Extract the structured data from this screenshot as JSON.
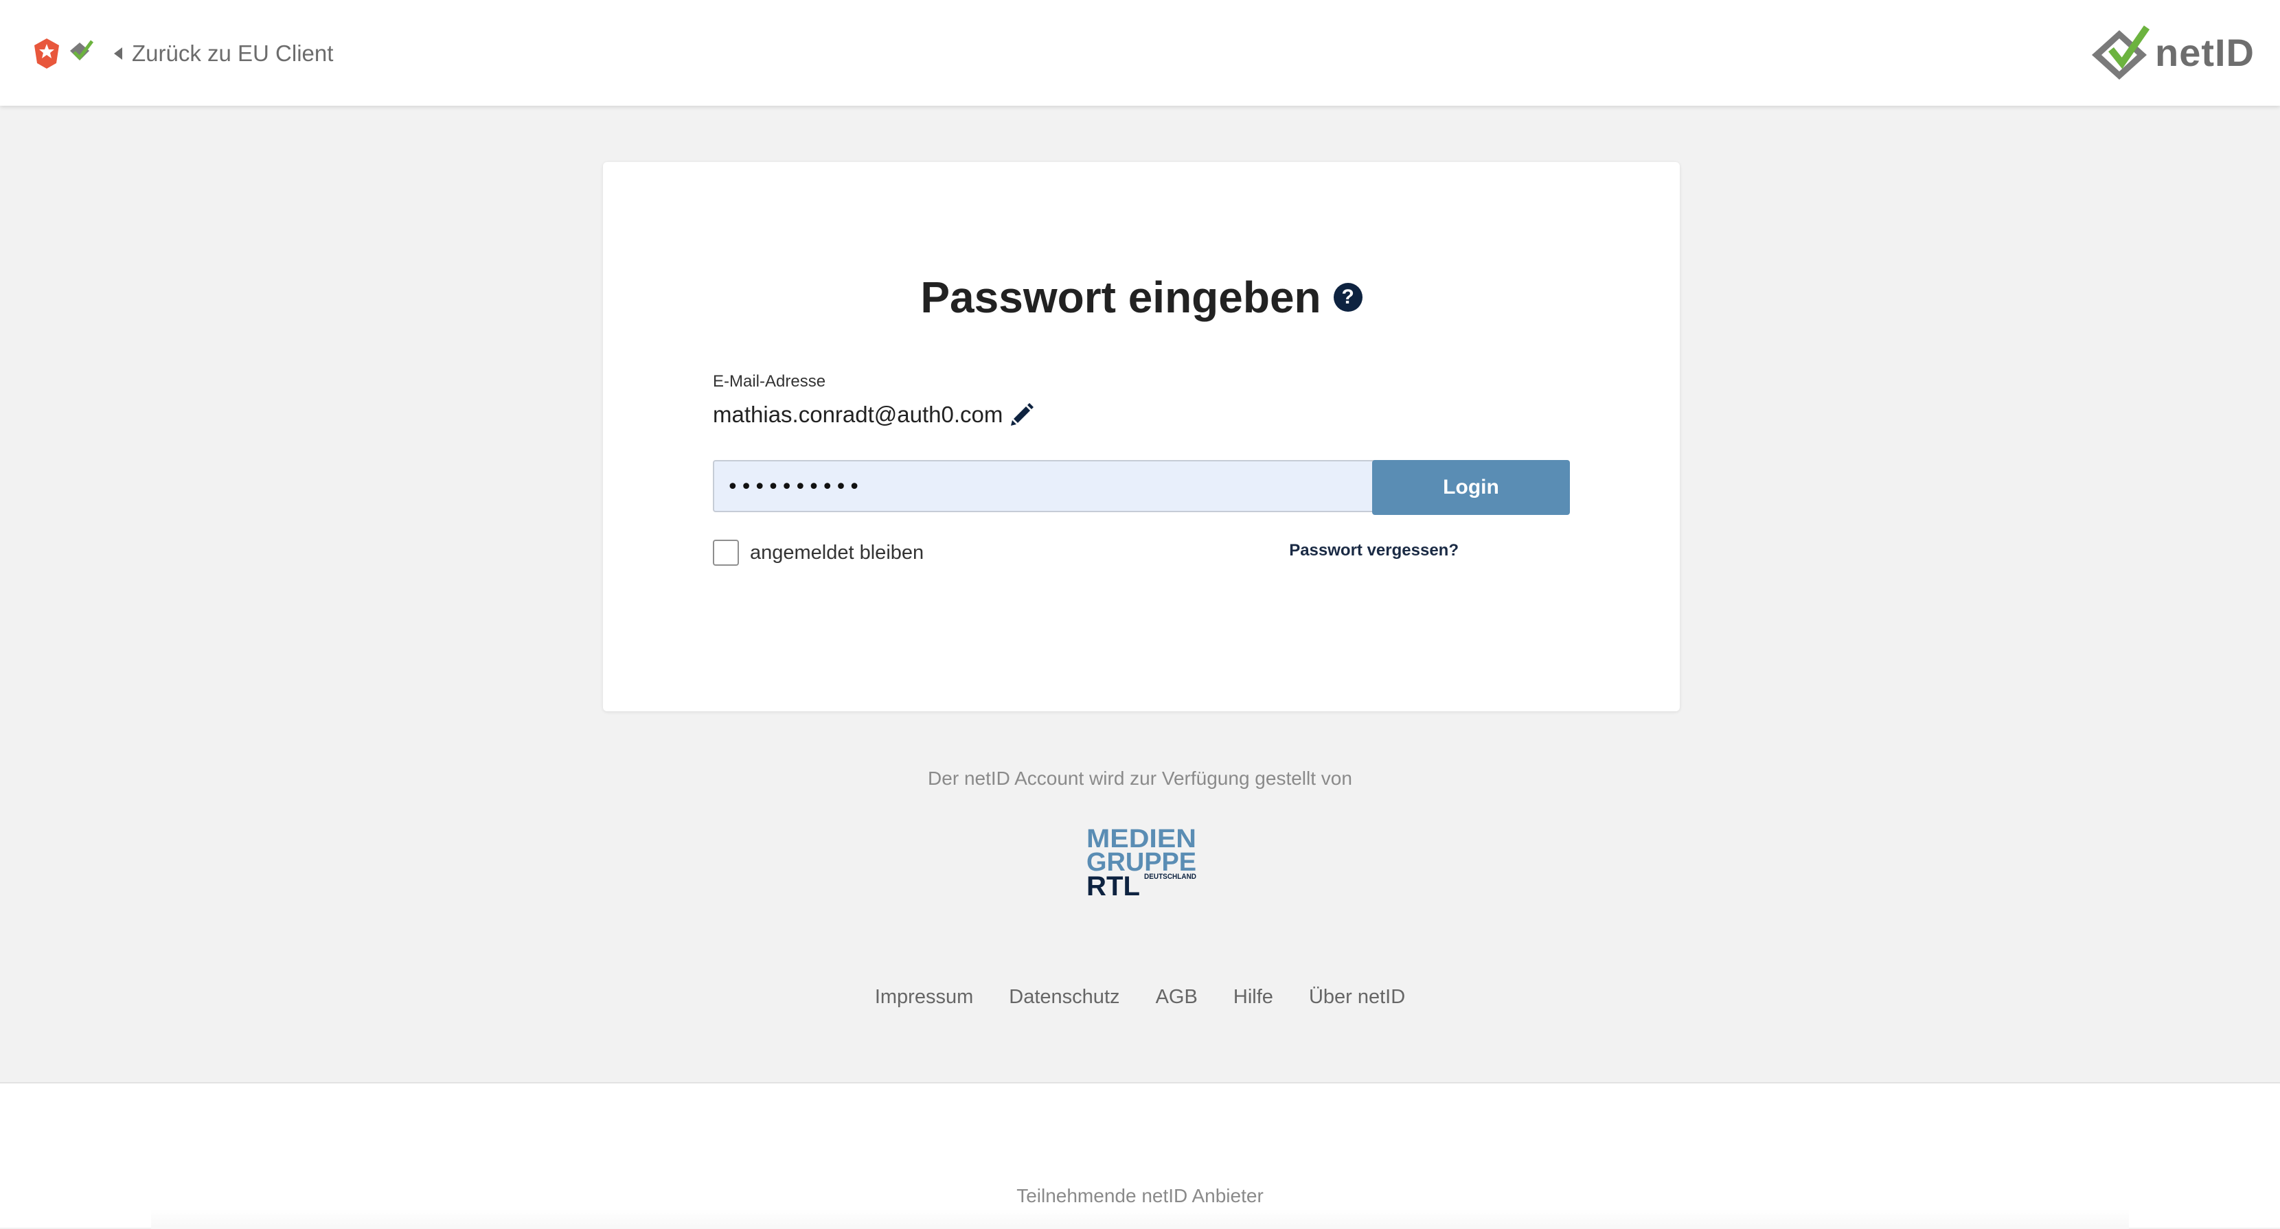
{
  "header": {
    "back_label": "Zurück zu EU Client",
    "brand_name": "netID"
  },
  "login": {
    "title": "Passwort eingeben",
    "email_label": "E-Mail-Adresse",
    "email_value": "mathias.conradt@auth0.com",
    "password_value": "••••••••••",
    "login_button": "Login",
    "remember_label": "angemeldet bleiben",
    "forgot_label": "Passwort vergessen?"
  },
  "provider": {
    "text": "Der netID Account wird zur Verfügung gestellt von",
    "logo_text": "MEDIEN GRUPPE RTL DEUTSCHLAND"
  },
  "footer": {
    "links": [
      "Impressum",
      "Datenschutz",
      "AGB",
      "Hilfe",
      "Über netID"
    ]
  },
  "partners": {
    "title": "Teilnehmende netID Anbieter"
  },
  "colors": {
    "primary_button": "#5a8db4",
    "help_icon": "#0e2340",
    "netid_green": "#6cb33f",
    "page_background": "#f2f2f2"
  },
  "icons": [
    "client-logo-icon",
    "chevron-left-icon",
    "netid-logo-icon",
    "question-icon",
    "pencil-icon",
    "eye-icon"
  ]
}
